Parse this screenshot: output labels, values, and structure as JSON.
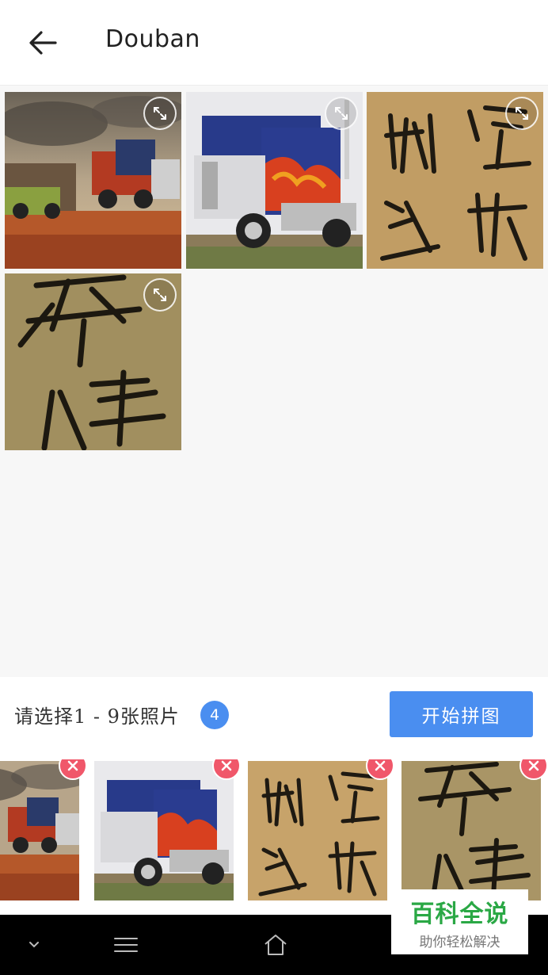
{
  "header": {
    "title": "Douban",
    "back_icon": "arrow-left-icon"
  },
  "grid": {
    "photos": [
      {
        "subject": "trucks-desert",
        "expand_icon": "expand-icon"
      },
      {
        "subject": "flame-truck",
        "expand_icon": "expand-icon"
      },
      {
        "subject": "calligraphy-1",
        "expand_icon": "expand-icon"
      },
      {
        "subject": "calligraphy-2",
        "expand_icon": "expand-icon"
      }
    ]
  },
  "selection": {
    "label": "请选择1 - 9张照片",
    "count": "4",
    "start_button": "开始拼图",
    "thumbnails": [
      {
        "subject": "trucks-desert",
        "remove_icon": "remove-icon"
      },
      {
        "subject": "flame-truck",
        "remove_icon": "remove-icon"
      },
      {
        "subject": "calligraphy-1",
        "remove_icon": "remove-icon"
      },
      {
        "subject": "calligraphy-2",
        "remove_icon": "remove-icon"
      }
    ]
  },
  "navbar": {
    "items": [
      "chevron-down-icon",
      "menu-icon",
      "home-icon"
    ]
  },
  "watermark": {
    "title": "百科全说",
    "subtitle": "助你轻松解决"
  },
  "colors": {
    "accent": "#4a8ef0",
    "remove": "#f0576a",
    "watermark_green": "#2aa845"
  }
}
